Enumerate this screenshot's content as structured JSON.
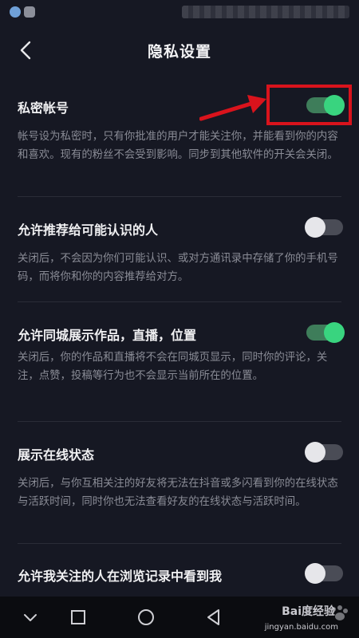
{
  "header": {
    "title": "隐私设置"
  },
  "settings": [
    {
      "title": "私密帐号",
      "desc": "帐号设为私密时，只有你批准的用户才能关注你，并能看到你的内容和喜欢。现有的粉丝不会受到影响。同步到其他软件的开关会关闭。",
      "on": true
    },
    {
      "title": "允许推荐给可能认识的人",
      "desc": "关闭后，不会因为你们可能认识、或对方通讯录中存储了你的手机号码，而将你和你的内容推荐给对方。",
      "on": false
    },
    {
      "title": "允许同城展示作品，直播，位置",
      "desc": "关闭后，你的作品和直播将不会在同城页显示，同时你的评论，关注，点赞，投稿等行为也不会显示当前所在的位置。",
      "on": true
    },
    {
      "title": "展示在线状态",
      "desc": "关闭后，与你互相关注的好友将无法在抖音或多闪看到你的在线状态与活跃时间，同时你也无法查看好友的在线状态与活跃时间。",
      "on": false
    },
    {
      "title": "允许我关注的人在浏览记录中看到我",
      "on": false
    }
  ],
  "watermark": {
    "text": "Bai度经验",
    "sub": "jingyan.baidu.com"
  },
  "colors": {
    "toggle_on": "#39d47f",
    "annotation": "#d9131c",
    "background": "#161823"
  }
}
